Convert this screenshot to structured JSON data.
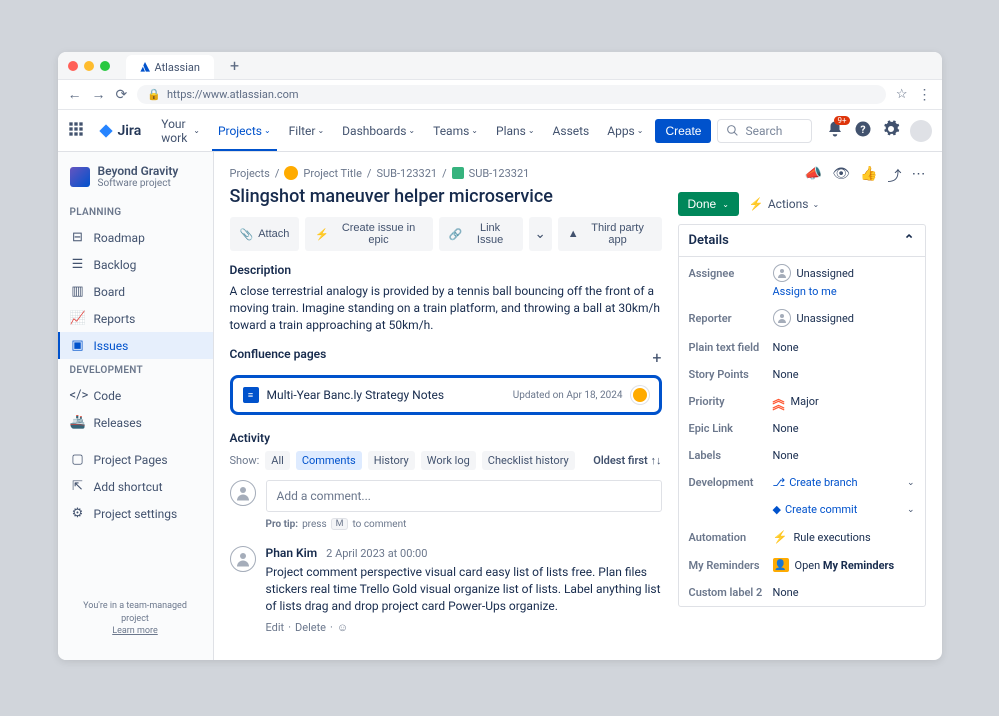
{
  "browser": {
    "tab_name": "Atlassian",
    "url": "https://www.atlassian.com"
  },
  "top_nav": {
    "logo": "Jira",
    "items": [
      "Your work",
      "Projects",
      "Filter",
      "Dashboards",
      "Teams",
      "Plans",
      "Assets",
      "Apps"
    ],
    "active_index": 1,
    "create": "Create",
    "search_placeholder": "Search",
    "notif_badge": "9+"
  },
  "sidebar": {
    "project_name": "Beyond Gravity",
    "project_type": "Software project",
    "planning_header": "PLANNING",
    "dev_header": "DEVELOPMENT",
    "planning": [
      "Roadmap",
      "Backlog",
      "Board",
      "Reports",
      "Issues"
    ],
    "development": [
      "Code",
      "Releases"
    ],
    "other": [
      "Project Pages",
      "Add shortcut",
      "Project settings"
    ],
    "footer1": "You're in a team-managed project",
    "footer2": "Learn more"
  },
  "breadcrumbs": {
    "projects": "Projects",
    "title": "Project Title",
    "key1": "SUB-123321",
    "key2": "SUB-123321"
  },
  "issue": {
    "title": "Slingshot maneuver helper microservice",
    "actions": {
      "attach": "Attach",
      "create_epic": "Create issue in epic",
      "link": "Link Issue",
      "third_party": "Third party app"
    },
    "desc_header": "Description",
    "description": "A close terrestrial analogy is provided by a tennis ball bouncing off the front of a moving train. Imagine standing on a train platform, and throwing a ball at 30km/h toward a train approaching at 50km/h.",
    "confluence_header": "Confluence pages",
    "confluence": {
      "title": "Multi-Year Banc.ly Strategy Notes",
      "updated": "Updated on Apr 18, 2024"
    }
  },
  "activity": {
    "header": "Activity",
    "show": "Show:",
    "tabs": [
      "All",
      "Comments",
      "History",
      "Work log",
      "Checklist history"
    ],
    "sort": "Oldest first",
    "add_placeholder": "Add a comment...",
    "protip_label": "Pro tip:",
    "protip_text1": "press",
    "protip_key": "M",
    "protip_text2": "to comment",
    "comment": {
      "author": "Phan Kim",
      "date": "2 April 2023 at 00:00",
      "text": "Project comment perspective visual card easy list of lists free. Plan files stickers real time Trello Gold visual organize list of lists. Label anything list of lists drag and drop project card Power-Ups organize.",
      "edit": "Edit",
      "delete": "Delete"
    }
  },
  "status": {
    "done": "Done",
    "actions": "Actions"
  },
  "details": {
    "header": "Details",
    "rows": {
      "assignee": {
        "label": "Assignee",
        "value": "Unassigned",
        "assign_link": "Assign to me"
      },
      "reporter": {
        "label": "Reporter",
        "value": "Unassigned"
      },
      "plain": {
        "label": "Plain text field",
        "value": "None"
      },
      "story": {
        "label": "Story Points",
        "value": "None"
      },
      "priority": {
        "label": "Priority",
        "value": "Major"
      },
      "epic": {
        "label": "Epic Link",
        "value": "None"
      },
      "labels": {
        "label": "Labels",
        "value": "None"
      },
      "dev": {
        "label": "Development",
        "branch": "Create branch",
        "commit": "Create commit"
      },
      "automation": {
        "label": "Automation",
        "value": "Rule executions"
      },
      "reminders": {
        "label": "My Reminders",
        "value_prefix": "Open ",
        "value_bold": "My Reminders"
      },
      "custom2": {
        "label": "Custom label 2",
        "value": "None"
      }
    }
  }
}
